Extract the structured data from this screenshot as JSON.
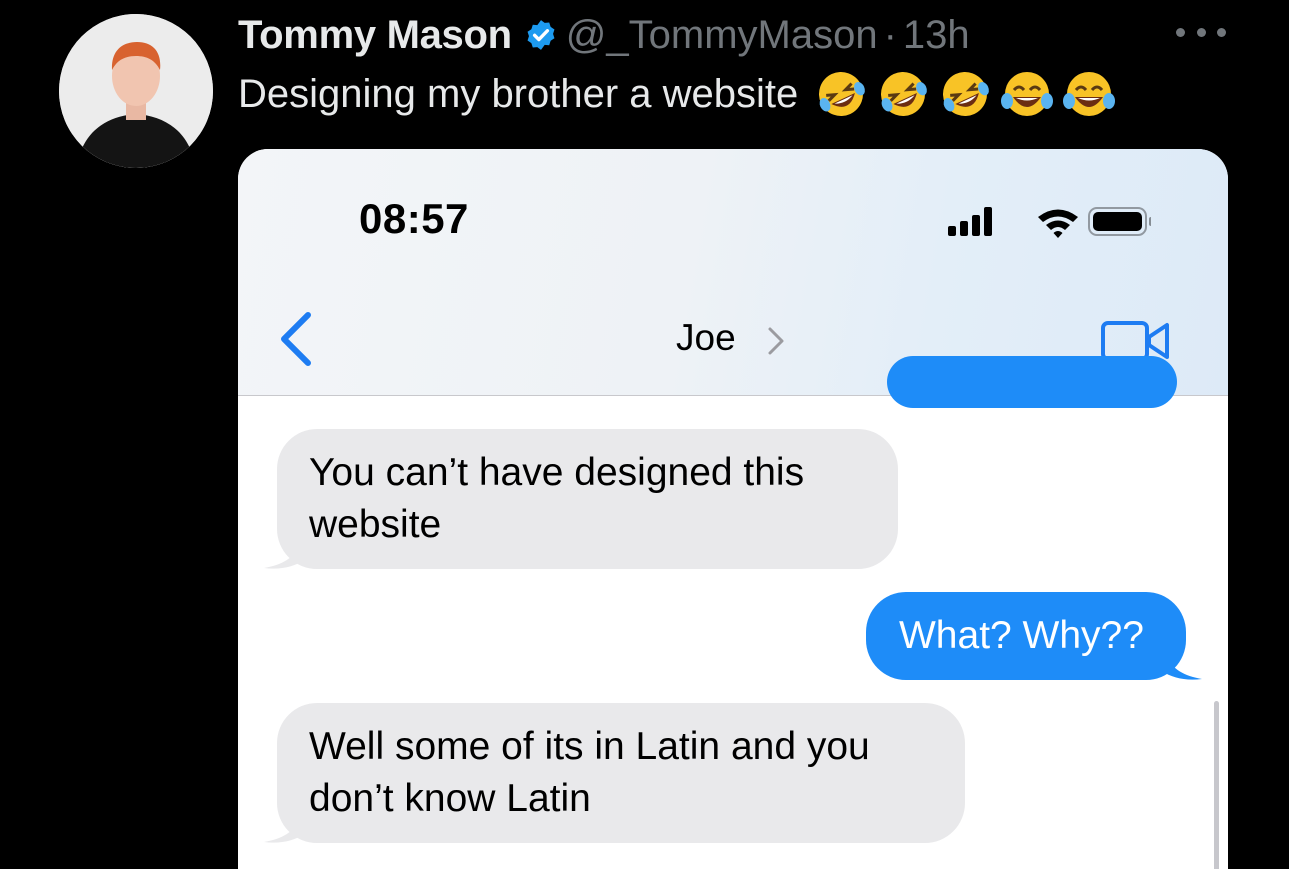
{
  "tweet": {
    "display_name": "Tommy Mason",
    "handle": "@_TommyMason",
    "separator": "·",
    "time": "13h",
    "text": "Designing my brother a website",
    "emojis": [
      "rolling-on-floor-laughing",
      "rolling-on-floor-laughing",
      "rolling-on-floor-laughing",
      "tears-of-joy",
      "tears-of-joy"
    ],
    "icons": {
      "verified": "verified-badge-icon",
      "more": "more-options-icon",
      "avatar": "profile-photo"
    },
    "colors": {
      "background": "#000000",
      "text": "#e7e9ea",
      "muted": "#71767b",
      "verified": "#1d9bf0"
    }
  },
  "phone": {
    "status_bar": {
      "time": "08:57",
      "icons": [
        "cellular-signal-icon",
        "wifi-icon",
        "battery-icon"
      ]
    },
    "nav": {
      "back_icon": "back-chevron-icon",
      "contact_name": "Joe",
      "contact_chevron": "chevron-right-icon",
      "video_icon": "facetime-video-icon"
    },
    "messages": [
      {
        "direction": "incoming",
        "lines": [
          "You can’t have designed this",
          "website"
        ]
      },
      {
        "direction": "outgoing",
        "lines": [
          "What? Why??"
        ]
      },
      {
        "direction": "incoming",
        "lines": [
          "Well some of its in Latin and you",
          "don’t know Latin"
        ]
      }
    ],
    "colors": {
      "incoming_bubble": "#e9e9eb",
      "outgoing_bubble": "#1e8cf8",
      "ios_blue": "#1e7cf2"
    }
  }
}
